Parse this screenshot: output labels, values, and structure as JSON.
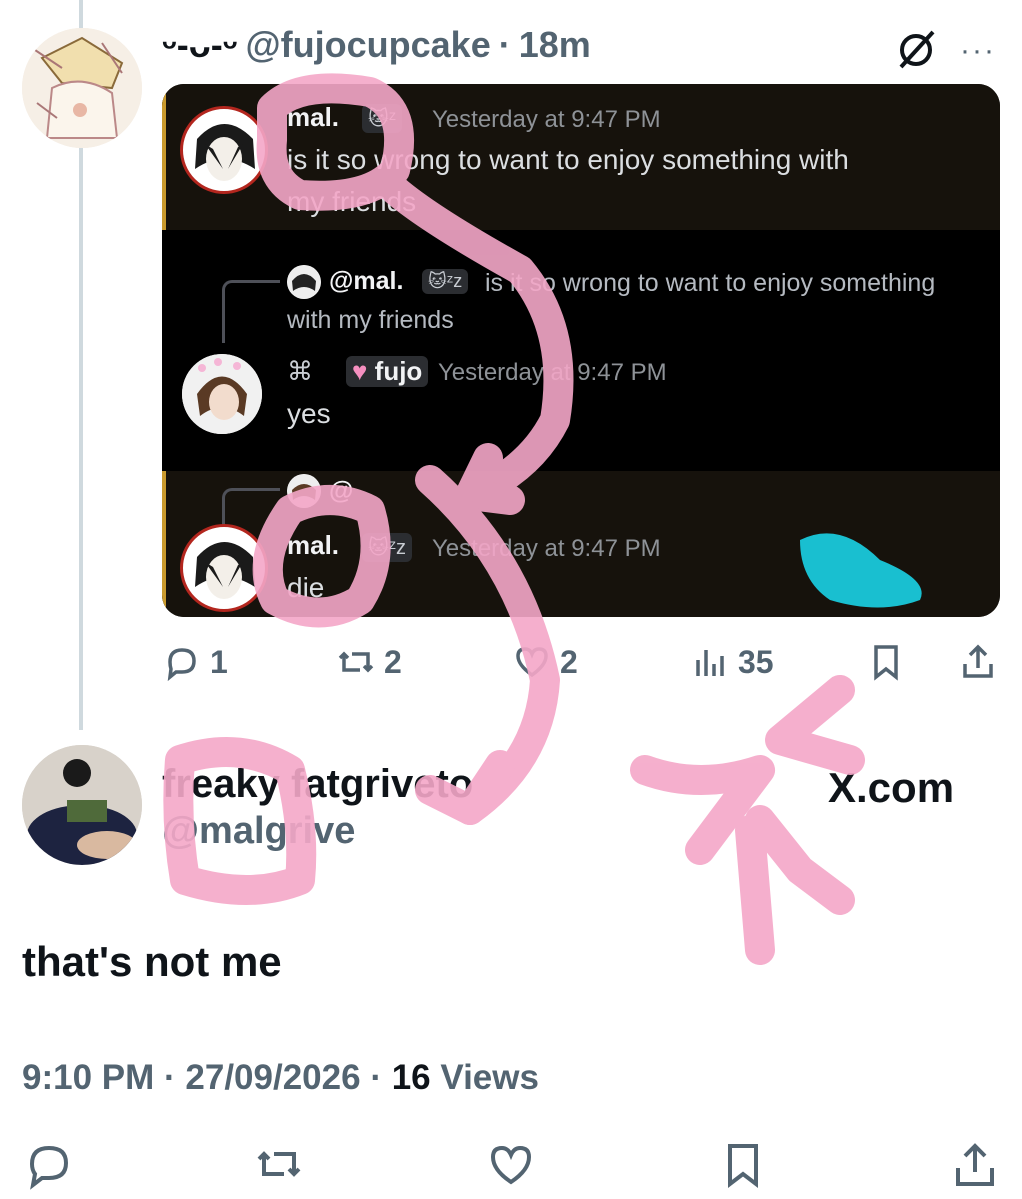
{
  "quoted_tweet": {
    "display_name": "ᵕ-ᴗ-ᵕ",
    "handle": "@fujocupcake",
    "separator": "·",
    "time": "18m",
    "icons": [
      "grok-icon",
      "more-icon"
    ]
  },
  "chat": {
    "msg1": {
      "name": "mal.",
      "tag": "🐱ᶻ",
      "time": "Yesterday at 9:47 PM",
      "text_line1": "is it so wrong to want to enjoy something with",
      "text_line2": "my friends"
    },
    "msg2": {
      "reply_name": "@mal.",
      "reply_tag": "🐱ᶻz",
      "reply_text_line1": "is it so wrong to want to enjoy something",
      "reply_text_line2": "with my friends",
      "name_prefix": "⌘",
      "name": "fujo",
      "time": "Yesterday at 9:47 PM",
      "text": "yes"
    },
    "msg3": {
      "reply_prefix": "@",
      "name": "mal.",
      "tag": "🐱ᶻz",
      "time": "Yesterday at 9:47 PM",
      "text": "die"
    }
  },
  "actions": {
    "replies": "1",
    "reposts": "2",
    "likes": "2",
    "views": "35"
  },
  "main_tweet": {
    "display_name": "freaky fatgriveto",
    "handle": "@malgrive",
    "source": "X.com",
    "text": "that's not me",
    "time": "9:10 PM",
    "date": "27/09/2026",
    "sep": "·",
    "views_count": "16",
    "views_label": "Views"
  },
  "colors": {
    "secondary_text": "#536471",
    "scribble_pink": "#f4a7c8",
    "scribble_cyan": "#19d3e6",
    "chat_bg": "#000000"
  }
}
